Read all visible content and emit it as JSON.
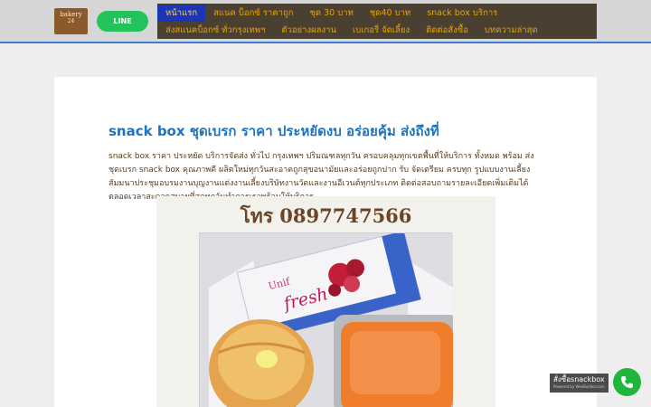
{
  "header": {
    "logo_text_1": "bakery",
    "logo_text_2": "24",
    "line_button": "LINE"
  },
  "nav": {
    "row1": [
      {
        "label": "หน้าแรก",
        "active": true
      },
      {
        "label": "สแนค บ็อกซ์ ราคาถูก",
        "active": false
      },
      {
        "label": "ชุด 30 บาท",
        "active": false
      },
      {
        "label": "ชุด40 บาท",
        "active": false
      },
      {
        "label": "snack box บริการ",
        "active": false
      }
    ],
    "row2": [
      {
        "label": "ส่งสแนคบ็อกซ์ ทั่วกรุงเทพฯ",
        "active": false
      },
      {
        "label": "ตัวอย่างผลงาน",
        "active": false
      },
      {
        "label": "เบเกอรี่ จัดเลี้ยง",
        "active": false
      },
      {
        "label": "ติดต่อสั่งซื้อ",
        "active": false
      },
      {
        "label": "บทความล่าสุด",
        "active": false
      }
    ]
  },
  "post": {
    "title": "snack box ชุดเบรก ราคา ประหยัดงบ อร่อยคุ้ม ส่งถึงที่",
    "body": "snack box ราคา ประหยัด บริการจัดส่ง ทั่วไป กรุงเทพฯ ปริมณฑลทุกวัน ครอบคลุมทุกเขตพื้นที่ให้บริการ ทั้งหมด พร้อม ส่ง ชุดเบรก snack box คุณภาพดี ผลิตใหม่ทุกวันสะอาดถูกสุขอนามัยและอร่อยถูกปาก รับ จัดเตรียม ครบทุก รูปแบบงานเลี้ยง สัมมนาประชุมอบรมงานบุญงานแต่งงานเลี้ยงบริษัทงานวัดและงานอีเวนต์ทุกประเภท ติดต่อสอบถามรายละเอียดเพิ่มเติมได้ตลอดเวลาสะดวกสบายที่สุดทุกวันทำการเราพร้อมให้บริการ"
  },
  "photo": {
    "tel": "โทร 0897747566",
    "carton_brand": "Unif",
    "carton_word": "fresh"
  },
  "badge": {
    "line1": "สั่งซื้อsnackbox",
    "line2": "Powered by WeeBuilder.com"
  },
  "colors": {
    "nav_bg": "#4a4032",
    "nav_text": "#e8a300",
    "nav_active_bg": "#1a35b5",
    "title": "#1e73be",
    "line_green": "#21c35a",
    "phone_green": "#20b53d"
  }
}
